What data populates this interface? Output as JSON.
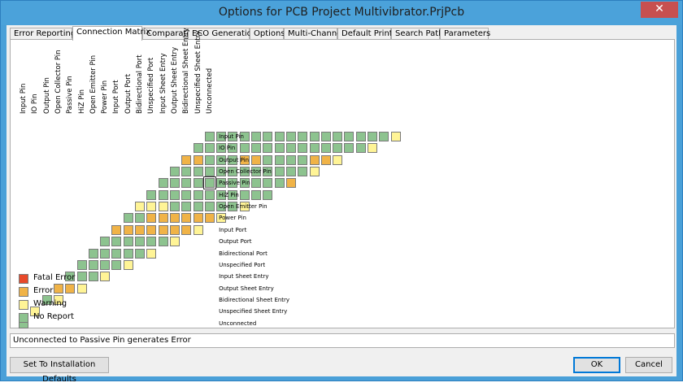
{
  "window": {
    "title": "Options for PCB Project Multivibrator.PrjPcb",
    "close_glyph": "✕"
  },
  "tabs": [
    {
      "label": "Error Reporting",
      "active": false
    },
    {
      "label": "Connection Matrix",
      "active": true
    },
    {
      "label": "Comparator",
      "active": false
    },
    {
      "label": "ECO Generation",
      "active": false
    },
    {
      "label": "Options",
      "active": false
    },
    {
      "label": "Multi-Channel",
      "active": false
    },
    {
      "label": "Default Prints",
      "active": false
    },
    {
      "label": "Search Paths",
      "active": false
    },
    {
      "label": "Parameters",
      "active": false
    }
  ],
  "matrix": {
    "pin_types": [
      "Input Pin",
      "IO Pin",
      "Output Pin",
      "Open Collector Pin",
      "Passive Pin",
      "HiZ Pin",
      "Open Emitter Pin",
      "Power Pin",
      "Input Port",
      "Output Port",
      "Bidirectional Port",
      "Unspecified Port",
      "Input Sheet Entry",
      "Output Sheet Entry",
      "Bidirectional Sheet Entry",
      "Unspecified Sheet Entry",
      "Unconnected"
    ],
    "colors": {
      "N": "#8dc38f",
      "W": "#fff496",
      "E": "#f0b347",
      "F": "#e8492a"
    },
    "selected_cell": [
      4,
      16
    ],
    "rows": [
      "NNNNNNNNNNNNNNNNW",
      "NNNNNNNNNNNNNNNW",
      "EENNNEENNNNEEW",
      "NNNNNNNNNNNNW",
      "NNNNNNNNNNNE",
      "NNNNNNNNNNN",
      "WWWNNNNNNW",
      "NNEEEEEEW",
      "EEEEEEEW",
      "NNNNNNW",
      "NNNNNW",
      "NNNNW",
      "NNNW",
      "EEW",
      "NW",
      "W",
      "N"
    ]
  },
  "legend": [
    {
      "label": "Fatal Error",
      "color": "#e8492a"
    },
    {
      "label": "Error",
      "color": "#f0b347"
    },
    {
      "label": "Warning",
      "color": "#fff496"
    },
    {
      "label": "No Report",
      "color": "#8dc38f"
    }
  ],
  "status": {
    "text": "Unconnected to Passive Pin generates Error"
  },
  "buttons": {
    "defaults": "Set To Installation Defaults",
    "ok": "OK",
    "cancel": "Cancel"
  }
}
